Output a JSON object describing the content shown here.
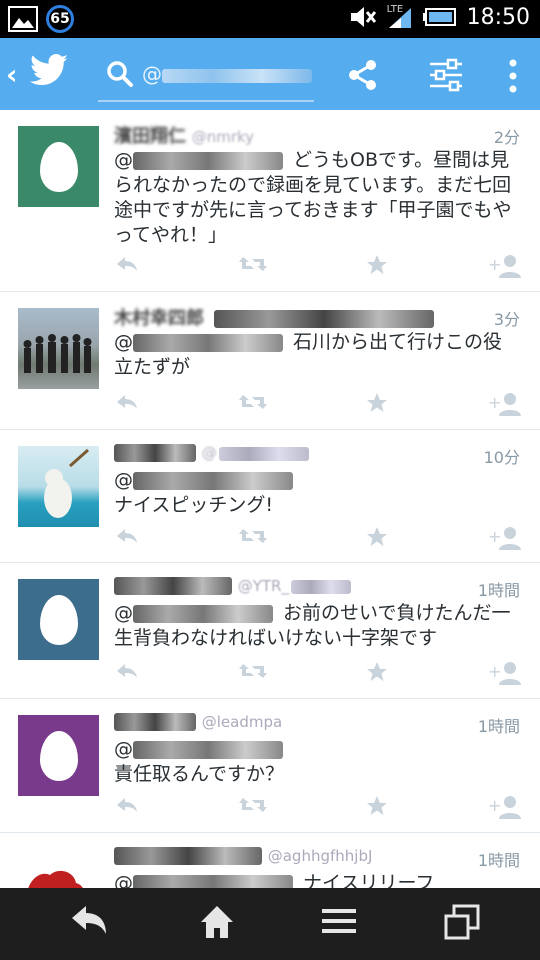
{
  "status_bar": {
    "notification_count": "65",
    "network": "LTE",
    "time": "18:50",
    "icons": [
      "image-notification-icon",
      "mute-icon",
      "signal-icon",
      "battery-icon"
    ]
  },
  "action_bar": {
    "search_query": "@",
    "background_color": "#55acee",
    "icons": [
      "back-icon",
      "twitter-bird-icon",
      "search-icon",
      "share-icon",
      "filter-icon",
      "overflow-menu-icon"
    ]
  },
  "tweets": [
    {
      "name": "濱田翔仁",
      "handle": "@nmrky",
      "time": "2分",
      "mention": "@",
      "text": "どうもOBです。昼間は見られなかったので録画を見ています。まだ七回途中ですが先に言っておきます「甲子園でもやってやれ！」",
      "avatar": "egg",
      "avatar_color": "#3a8a6a"
    },
    {
      "name": "木村幸四郎",
      "handle": "",
      "time": "3分",
      "mention": "@",
      "text": "石川から出て行けこの役立たずが",
      "avatar": "photo-group",
      "avatar_color": "#8a9aa8"
    },
    {
      "name": "",
      "handle": "@",
      "time": "10分",
      "mention": "@",
      "text": "ナイスピッチング!",
      "avatar": "photo-dog",
      "avatar_color": "#2aa0c0"
    },
    {
      "name": "",
      "handle": "@YTR_",
      "time": "1時間",
      "mention": "@",
      "text": "お前のせいで負けたんだ一生背負わなければいけない十字架です",
      "avatar": "egg",
      "avatar_color": "#3d6d8c"
    },
    {
      "name": "",
      "handle": "@leadmpa",
      "time": "1時間",
      "mention": "@",
      "text": "責任取るんですか？",
      "avatar": "egg",
      "avatar_color": "#7a3a8c"
    },
    {
      "name": "",
      "handle": "@aghhgfhhjbJ",
      "time": "1時間",
      "mention": "@",
      "text": "ナイスリリーフ",
      "avatar": "photo-red",
      "avatar_color": "#c02020"
    }
  ],
  "tweet_actions": [
    "reply-icon",
    "retweet-icon",
    "favorite-icon",
    "follow-icon"
  ],
  "nav_bar": {
    "icons": [
      "nav-back-icon",
      "home-icon",
      "menu-icon",
      "recent-apps-icon"
    ]
  }
}
